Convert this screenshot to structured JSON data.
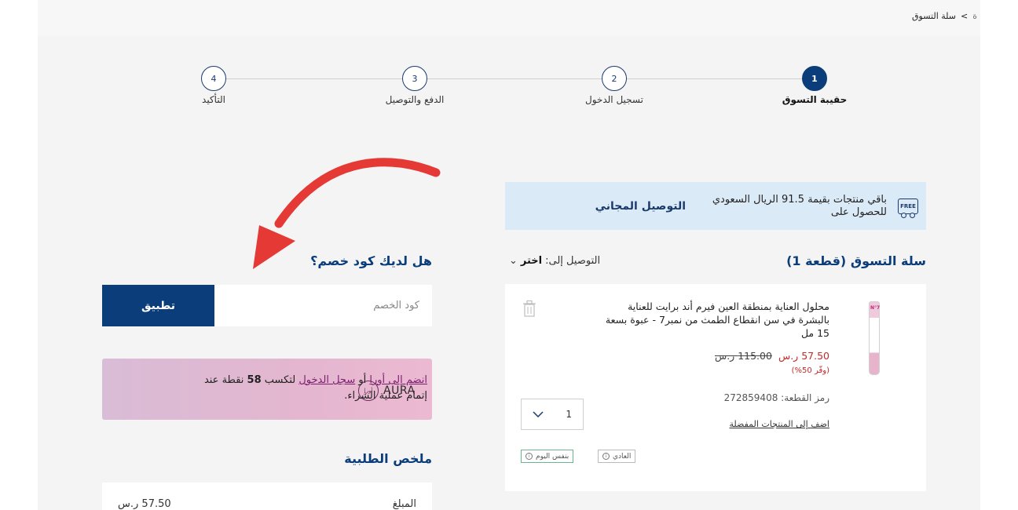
{
  "breadcrumb": {
    "prev": "ة",
    "separator": ">",
    "current": "سلة التسوق"
  },
  "stepper": {
    "steps": [
      {
        "num": "1",
        "label": "حقيبة التسوق"
      },
      {
        "num": "2",
        "label": "تسجيل الدخول"
      },
      {
        "num": "3",
        "label": "الدفع والتوصيل"
      },
      {
        "num": "4",
        "label": "التأكيد"
      }
    ]
  },
  "banner": {
    "icon_text": "FREE",
    "text": "باقي منتجات بقيمة 91.5 الريال السعودي للحصول على",
    "strong": "التوصيل المجاني"
  },
  "cart": {
    "title": "سلة التسوق (قطعة 1)",
    "deliver_label": "التوصيل إلى:",
    "deliver_value": "اختر",
    "deliver_chevron": "⌄"
  },
  "product": {
    "brand_mark": "N°7",
    "name": "محلول العناية بمنطقة العين فيرم أند برايت للعناية بالبشرة في سن انقطاع الطمث من نمبر7 - عبوة بسعة 15 مل",
    "price_new": "57.50 ر.س",
    "price_old": "115.00 ر.س",
    "save": "(وفّر 50%)",
    "code": "رمز القطعة: 272859408",
    "wishlist": "اضف إلى المنتجات المفضلة",
    "qty": "1",
    "chip_regular": "العادي",
    "chip_sameday": "بنفس اليوم",
    "info": "i"
  },
  "coupon": {
    "title": "هل لديك كود خصم؟",
    "placeholder": "كود الخصم",
    "apply": "تطبيق"
  },
  "aura": {
    "join_link": "انضم إلى أورا",
    "or": "أو",
    "login_link": "سجل الدخول",
    "text_pre": "لتكسب",
    "points": "58",
    "text_post": "نقطة عند إتمام عملية الشراء.",
    "logo_mark": "أورا",
    "logo_word": "AURA"
  },
  "summary": {
    "title": "ملخص الطلبية",
    "amount_label": "المبلغ",
    "amount_value": "57.50 ر.س"
  },
  "colors": {
    "primary": "#0b3d7a",
    "sale": "#c62828",
    "banner_bg": "#dbeaf7",
    "annotation_arrow": "#e53935"
  }
}
